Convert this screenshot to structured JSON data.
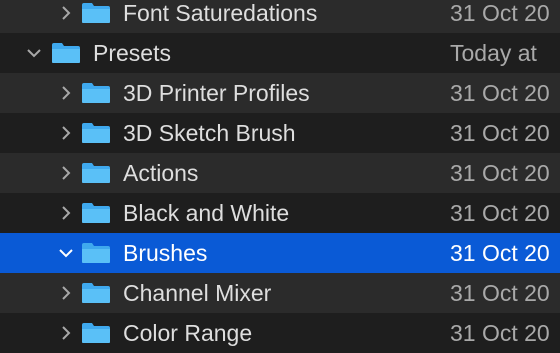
{
  "rows": [
    {
      "name": "Font Saturedations",
      "date": "31 Oct 20",
      "level": 2,
      "expanded": false,
      "icon": "chevron-right-icon"
    },
    {
      "name": "Presets",
      "date": "Today at",
      "level": 1,
      "expanded": true,
      "icon": "chevron-down-icon"
    },
    {
      "name": "3D Printer Profiles",
      "date": "31 Oct 20",
      "level": 2,
      "expanded": false,
      "icon": "chevron-right-icon"
    },
    {
      "name": "3D Sketch Brush",
      "date": "31 Oct 20",
      "level": 2,
      "expanded": false,
      "icon": "chevron-right-icon"
    },
    {
      "name": "Actions",
      "date": "31 Oct 20",
      "level": 2,
      "expanded": false,
      "icon": "chevron-right-icon"
    },
    {
      "name": "Black and White",
      "date": "31 Oct 20",
      "level": 2,
      "expanded": false,
      "icon": "chevron-right-icon"
    },
    {
      "name": "Brushes",
      "date": "31 Oct 20",
      "level": 2,
      "expanded": true,
      "selected": true,
      "icon": "chevron-down-icon"
    },
    {
      "name": "Channel Mixer",
      "date": "31 Oct 20",
      "level": 2,
      "expanded": false,
      "icon": "chevron-right-icon"
    },
    {
      "name": "Color Range",
      "date": "31 Oct 20",
      "level": 2,
      "expanded": false,
      "icon": "chevron-right-icon"
    }
  ],
  "colors": {
    "selection": "#0a5ad6",
    "folder": "#3fa9ee"
  }
}
